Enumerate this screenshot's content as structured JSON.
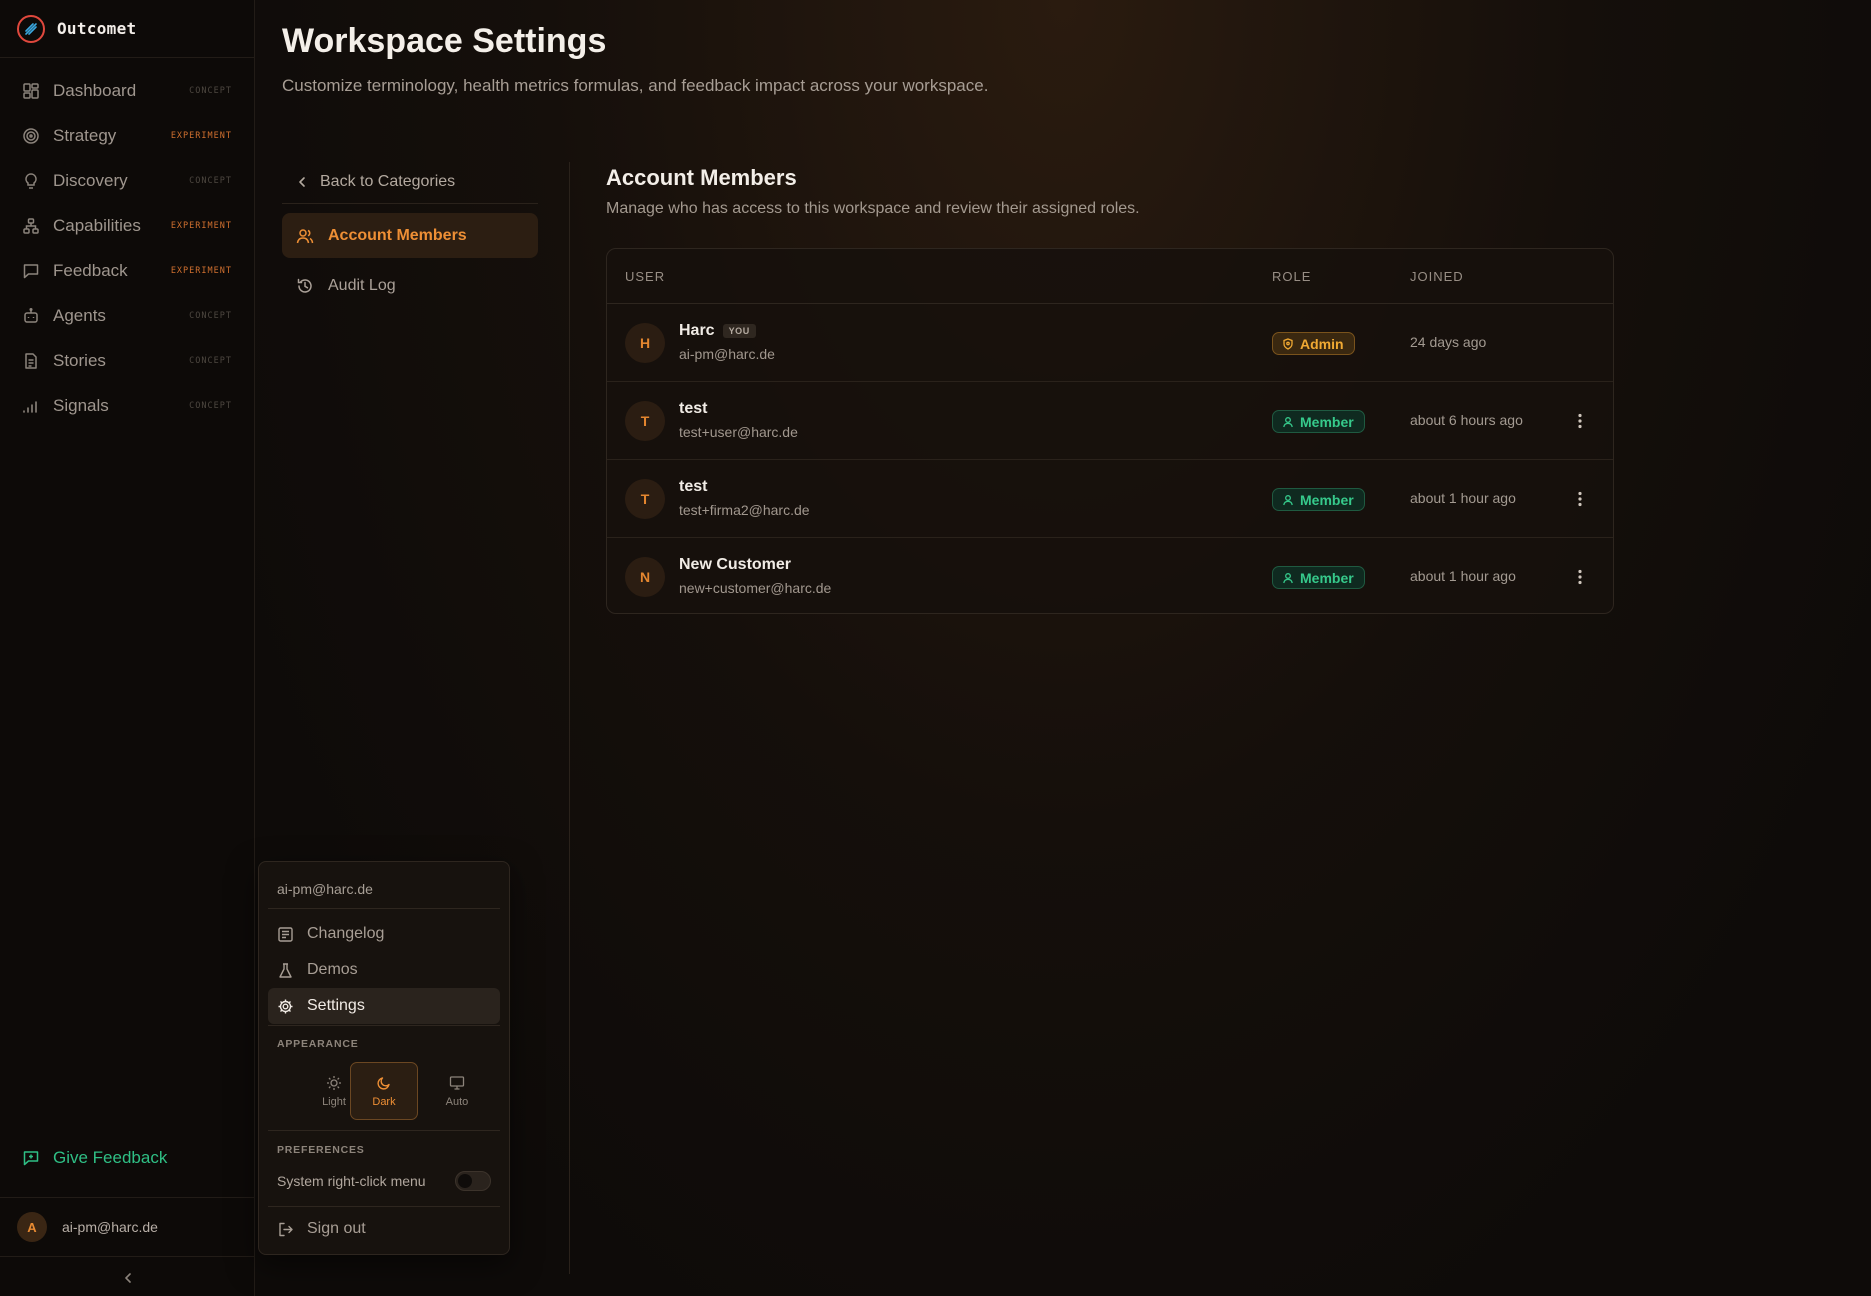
{
  "app": {
    "name": "Outcomet"
  },
  "sidebar": {
    "items": [
      {
        "label": "Dashboard",
        "tag": "CONCEPT",
        "icon": "layout-grid-icon"
      },
      {
        "label": "Strategy",
        "tag": "EXPERIMENT",
        "icon": "target-icon"
      },
      {
        "label": "Discovery",
        "tag": "CONCEPT",
        "icon": "lightbulb-icon"
      },
      {
        "label": "Capabilities",
        "tag": "EXPERIMENT",
        "icon": "network-icon"
      },
      {
        "label": "Feedback",
        "tag": "EXPERIMENT",
        "icon": "message-square-icon"
      },
      {
        "label": "Agents",
        "tag": "CONCEPT",
        "icon": "bot-icon"
      },
      {
        "label": "Stories",
        "tag": "CONCEPT",
        "icon": "file-text-icon"
      },
      {
        "label": "Signals",
        "tag": "CONCEPT",
        "icon": "signal-bars-icon"
      }
    ],
    "give_feedback": "Give Feedback",
    "user": {
      "initial": "A",
      "email": "ai-pm@harc.de"
    }
  },
  "page": {
    "title": "Workspace Settings",
    "subtitle": "Customize terminology, health metrics formulas, and feedback impact across your workspace."
  },
  "subnav": {
    "back": "Back to Categories",
    "items": [
      {
        "label": "Account Members",
        "active": true
      },
      {
        "label": "Audit Log",
        "active": false
      }
    ]
  },
  "members": {
    "title": "Account Members",
    "description": "Manage who has access to this workspace and review their assigned roles.",
    "columns": {
      "user": "USER",
      "role": "ROLE",
      "joined": "JOINED"
    },
    "rows": [
      {
        "initial": "H",
        "name": "Harc",
        "you": "YOU",
        "email": "ai-pm@harc.de",
        "role": "Admin",
        "joined": "24 days ago"
      },
      {
        "initial": "T",
        "name": "test",
        "email": "test+user@harc.de",
        "role": "Member",
        "joined": "about 6 hours ago"
      },
      {
        "initial": "T",
        "name": "test",
        "email": "test+firma2@harc.de",
        "role": "Member",
        "joined": "about 1 hour ago"
      },
      {
        "initial": "N",
        "name": "New Customer",
        "email": "new+customer@harc.de",
        "role": "Member",
        "joined": "about 1 hour ago"
      }
    ]
  },
  "user_menu": {
    "email": "ai-pm@harc.de",
    "items": [
      {
        "label": "Changelog"
      },
      {
        "label": "Demos"
      },
      {
        "label": "Settings"
      }
    ],
    "appearance_label": "APPEARANCE",
    "themes": [
      {
        "label": "Light"
      },
      {
        "label": "Dark",
        "selected": true
      },
      {
        "label": "Auto"
      }
    ],
    "preferences_label": "PREFERENCES",
    "pref_right_click": "System right-click menu",
    "pref_right_click_on": false,
    "sign_out": "Sign out"
  },
  "colors": {
    "accent": "#ee8f35",
    "success": "#36c98b",
    "admin": "#f0a933",
    "background": "#0e0b09"
  }
}
